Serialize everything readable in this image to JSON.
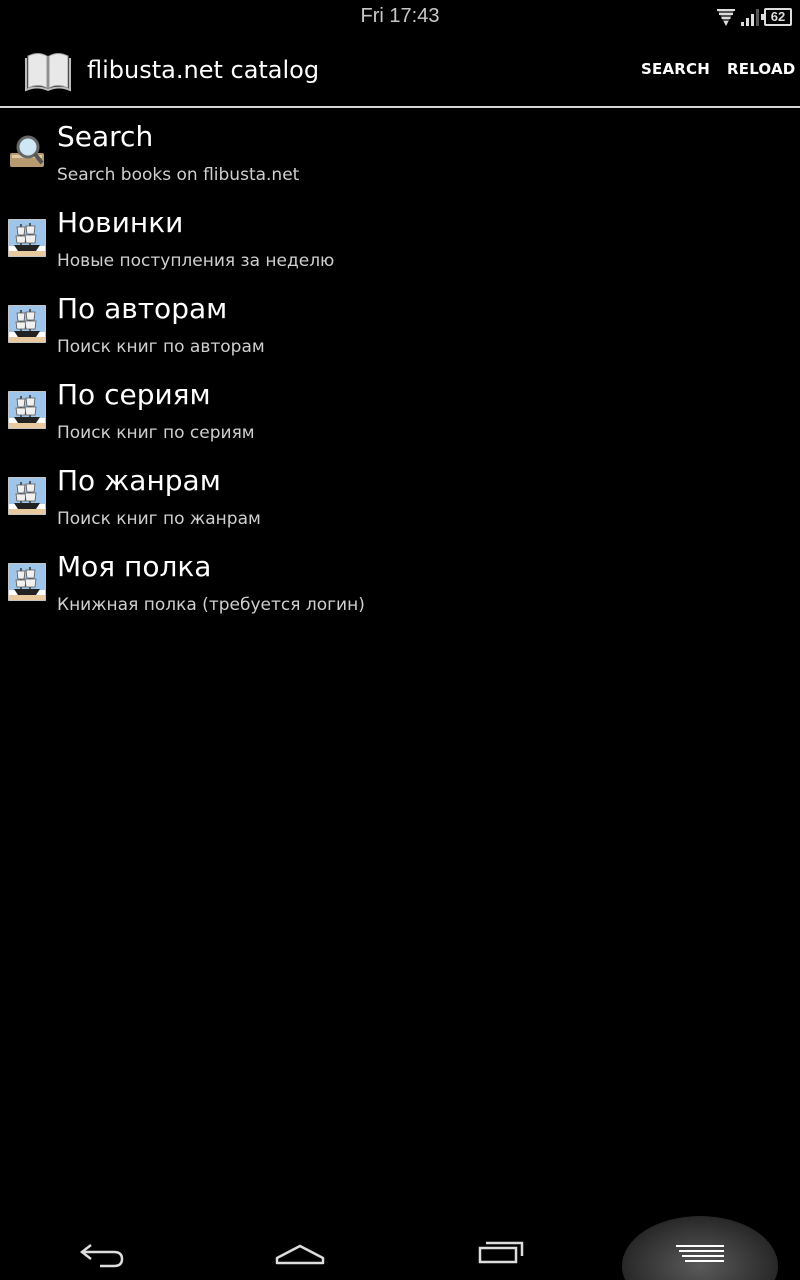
{
  "status_bar": {
    "time": "Fri 17:43",
    "battery_level": "62",
    "icons": [
      "wifi-icon",
      "signal-icon",
      "battery-icon"
    ]
  },
  "action_bar": {
    "title": "flibusta.net catalog",
    "app_icon": "book-icon",
    "actions": {
      "search_label": "SEARCH",
      "reload_label": "RELOAD"
    }
  },
  "catalog": {
    "items": [
      {
        "title": "Search",
        "subtitle": "Search books on flibusta.net",
        "icon": "magnifier-icon"
      },
      {
        "title": "Новинки",
        "subtitle": "Новые поступления за неделю",
        "icon": "ship-icon"
      },
      {
        "title": "По авторам",
        "subtitle": "Поиск книг по авторам",
        "icon": "ship-icon"
      },
      {
        "title": "По сериям",
        "subtitle": "Поиск книг по сериям",
        "icon": "ship-icon"
      },
      {
        "title": "По жанрам",
        "subtitle": "Поиск книг по жанрам",
        "icon": "ship-icon"
      },
      {
        "title": "Моя полка",
        "subtitle": "Книжная полка (требуется логин)",
        "icon": "ship-icon"
      }
    ]
  },
  "nav_bar": {
    "buttons": [
      "back-icon",
      "home-icon",
      "recent-apps-icon",
      "menu-icon"
    ]
  },
  "colors": {
    "background": "#000000",
    "divider": "#d6d6d6",
    "subtitle": "#cfcfcf"
  }
}
